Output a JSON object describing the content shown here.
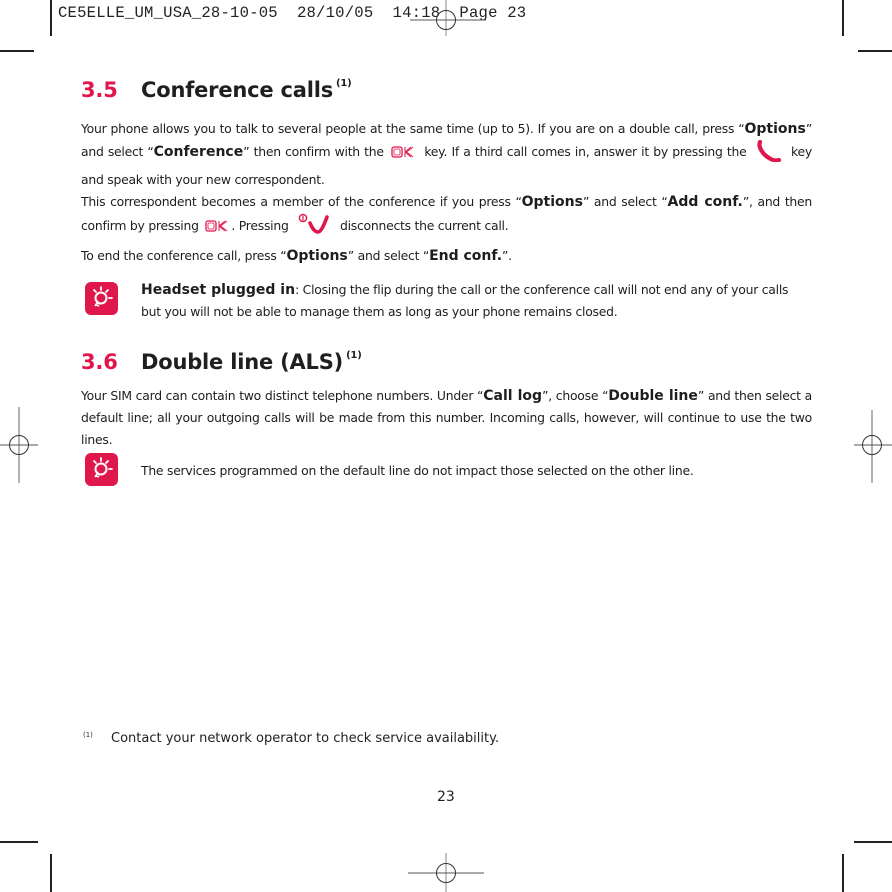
{
  "slug": {
    "text": "CE5ELLE_UM_USA_28-10-05  28/10/05  14:18  Page 23"
  },
  "colors": {
    "accent": "#e0174d",
    "text": "#1e1e1e"
  },
  "section_3_5": {
    "number": "3.5",
    "title": "Conference calls",
    "footnote_ref": "(1)",
    "para1": {
      "t1": "Your phone allows you to talk to several people at the same time (up to 5). If you are on a double call, press “",
      "b1": "Options",
      "t2": "” and select “",
      "b2": "Conference",
      "t3": "” then confirm with the",
      "icon1": "ok-key-icon",
      "t4": "key. If a third call comes in, answer it by pressing the",
      "icon2": "call-key-icon",
      "t5": "key and speak with your new correspondent."
    },
    "para2": {
      "t1": "This correspondent becomes a member of the conference if you press “",
      "b1": "Options",
      "t2": "” and select “",
      "b2": "Add conf.",
      "t3": "”, and then confirm by pressing",
      "icon1": "ok-key-icon",
      "t4": ". Pressing",
      "icon2": "end-call-key-icon",
      "t5": "disconnects the current call."
    },
    "para3": {
      "t1": "To end the conference call, press “",
      "b1": "Options",
      "t2": "” and select “",
      "b2": "End conf.",
      "t3": "”."
    },
    "tip": {
      "icon": "lightbulb-tip-icon",
      "bold": "Headset plugged in",
      "text": ": Closing the flip during the call or the conference call will not end any of your calls but you will not be able to manage them as long as your phone remains closed."
    }
  },
  "section_3_6": {
    "number": "3.6",
    "title": "Double line (ALS)",
    "footnote_ref": "(1)",
    "para1": {
      "t1": "Your SIM card can contain two distinct telephone numbers. Under “",
      "b1": "Call log",
      "t2": "”, choose “",
      "b2": "Double line",
      "t3": "” and then select a default line; all your outgoing calls will be made from this number. Incoming calls, however, will continue to use the two lines."
    },
    "tip": {
      "icon": "lightbulb-tip-icon",
      "text": "The services programmed on the default line do not impact those selected on the other line."
    }
  },
  "footnote": {
    "mark": "(1)",
    "text": "Contact your network operator to check service availability."
  },
  "page_number": "23"
}
